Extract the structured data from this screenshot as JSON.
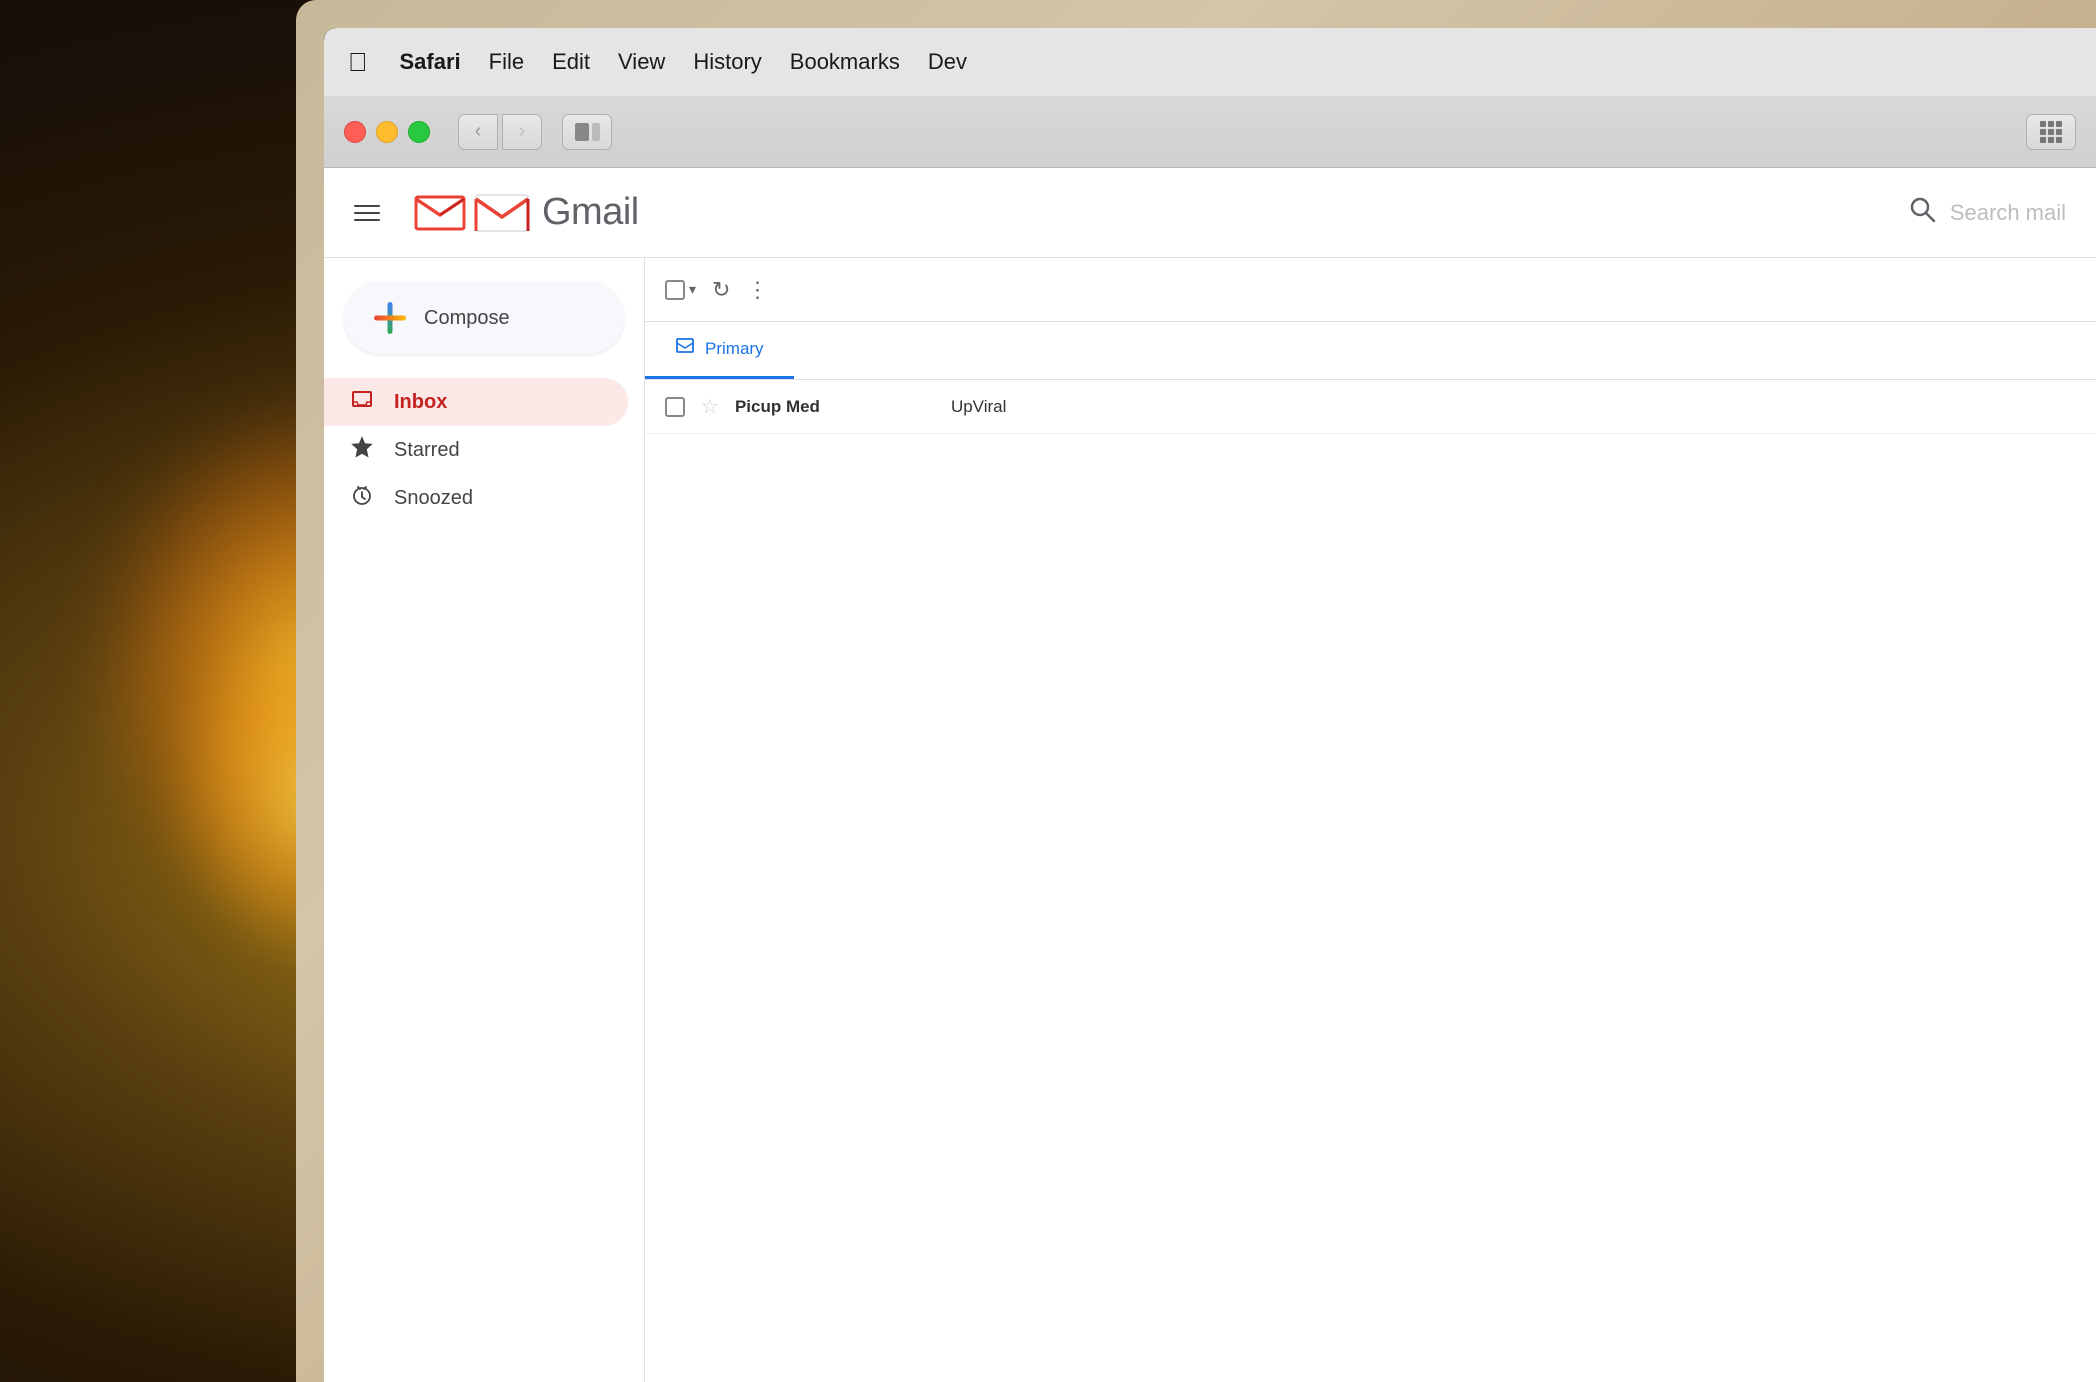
{
  "background": {
    "color_main": "#2a1a05",
    "color_light": "#ffcc44"
  },
  "menubar": {
    "apple_icon": "🍎",
    "items": [
      {
        "label": "Safari",
        "active": true
      },
      {
        "label": "File"
      },
      {
        "label": "Edit"
      },
      {
        "label": "View"
      },
      {
        "label": "History"
      },
      {
        "label": "Bookmarks"
      },
      {
        "label": "Dev"
      }
    ]
  },
  "browser": {
    "nav_back": "‹",
    "nav_forward": "›"
  },
  "gmail": {
    "logo_m": "M",
    "logo_wordmark": "Gmail",
    "search_placeholder": "Search mail",
    "compose_label": "Compose",
    "nav_items": [
      {
        "label": "Inbox",
        "icon": "inbox",
        "active": true
      },
      {
        "label": "Starred",
        "icon": "star",
        "active": false
      },
      {
        "label": "Snoozed",
        "icon": "clock",
        "active": false
      }
    ],
    "tabs": [
      {
        "label": "Primary",
        "icon": "inbox",
        "active": true
      }
    ],
    "email_rows": [
      {
        "sender": "Picup Med",
        "subject": "UpViral",
        "starred": false
      }
    ],
    "toolbar": {
      "more_dots": "⋮",
      "refresh_icon": "↻"
    }
  }
}
